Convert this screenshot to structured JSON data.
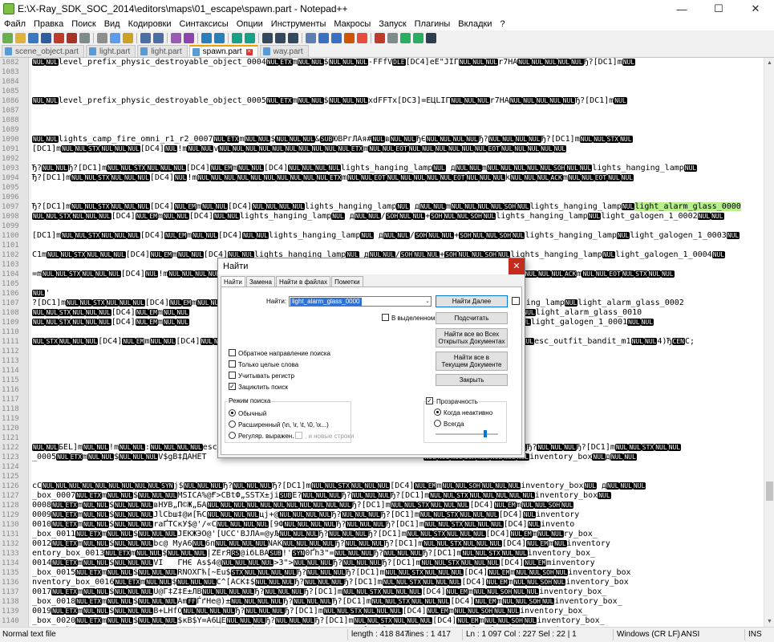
{
  "window": {
    "title": "E:\\X-Ray_SDK_SOC_2014\\editors\\maps\\01_escape\\spawn.part - Notepad++",
    "minimize": "—",
    "maximize": "☐",
    "close": "✕"
  },
  "menu": [
    "Файл",
    "Правка",
    "Поиск",
    "Вид",
    "Кодировки",
    "Синтаксисы",
    "Опции",
    "Инструменты",
    "Макросы",
    "Запуск",
    "Плагины",
    "Вкладки",
    "?"
  ],
  "tabs": [
    {
      "label": "scene_object.part",
      "active": false
    },
    {
      "label": "light.part",
      "active": false
    },
    {
      "label": "light.part",
      "active": false
    },
    {
      "label": "spawn.part",
      "active": true
    },
    {
      "label": "way.part",
      "active": false
    }
  ],
  "editor": {
    "lines": [
      {
        "n": "1082",
        "t": "[NUL][NUL]level_prefix_physic_destroyable_object_0004[NUL][ETX]m[NUL][NUL]$[NUL][NUL][NUL]-FFfV[DLE][DC4]eE\"JIГ[NUL][NUL][NUL]r7HA[NUL][NUL][NUL][NUL][NUL]Ђ?[DC1]m[NUL]"
      },
      {
        "n": "1083",
        "t": ""
      },
      {
        "n": "1084",
        "t": ""
      },
      {
        "n": "1085",
        "t": ""
      },
      {
        "n": "1086",
        "t": "[NUL][NUL]level_prefix_physic_destroyable_object_0005[NUL][ETX]m[NUL][NUL]$[NUL][NUL][NUL]xdFFTx[DC3]=ЕЦLIГ[NUL][NUL][NUL]r7HA[NUL][NUL][NUL][NUL][NUL]Ђ?[DC1]m[NUL]"
      },
      {
        "n": "1087",
        "t": ""
      },
      {
        "n": "1088",
        "t": ""
      },
      {
        "n": "1089",
        "t": ""
      },
      {
        "n": "1090",
        "t": "[NUL][NUL]lights_camp_fire_omni_r1_r2_0007[NUL][ETX]m[NUL][NUL]$[NUL][NUL][NUL]&[SUB]ЮВРгЛАя#[NUL]в[NUL][NUL]ЂЄ[NUL][NUL][NUL][NUL]Ђ?[NUL][NUL][NUL][NUL]Ђ?[DC1]m[NUL][NUL][STX][NUL]"
      },
      {
        "n": "1091",
        "t": "[DC1]m[NUL][NUL][STX][NUL][NUL][NUL][DC4][NUL]!m[NUL][NUL]v[NUL][NUL][NUL][NUL][NUL][NUL][NUL][NUL][NUL][NUL][ETX]m[NUL][NUL][EOT][NUL][NUL][NUL][NUL][NUL][NUL][EOT][NUL][NUL][NUL][NUL][NUL]"
      },
      {
        "n": "1092",
        "t": ""
      },
      {
        "n": "1093",
        "t": "Ђ?[NUL][NUL]Ђ?[DC1]m[NUL][NUL][STX][NUL][NUL][NUL][DC4][NUL][EM]m[NUL][NUL][DC4][NUL][NUL][NUL][NUL]lights_hanging_lamp[NUL] д[NUL][NUL]m[NUL][NUL][NUL][NUL][NUL][SOH][NUL][NUL]lights_hanging_lamp[NUL]"
      },
      {
        "n": "1094",
        "t": "Ђ?[DC1]m[NUL][NUL][STX][NUL][NUL][NUL][DC4][NUL]!m[NUL][NUL][NUL][NUL][NUL][NUL][NUL][NUL][NUL][NUL][ETX]m[NUL][NUL][EOT][NUL][NUL][NUL][NUL][NUL][EOT][NUL][NUL][NUL]k[NUL][NUL][NUL][ACK]m[NUL][NUL][EOT][NUL][NUL]"
      },
      {
        "n": "1095",
        "t": ""
      },
      {
        "n": "1096",
        "t": ""
      },
      {
        "n": "1097",
        "t": "Ђ?[DC1]m[NUL][NUL][STX][NUL][NUL][NUL][DC4][NUL][EM]m[NUL][NUL][DC4][NUL][NUL][NUL][NUL]lights_hanging_lamp[NUL] д[NUL][NUL]m[NUL][NUL][NUL][NUL][SOH][NUL]lights_hanging_lamp[NUL]{{hl}}"
      },
      {
        "n": "1098",
        "t": "[NUL][NUL][STX][NUL][NUL][NUL][DC4][NUL][EM]m[NUL][NUL][DC4][NUL][NUL]lights_hanging_lamp[NUL] д[NUL][NUL]/[SOH][NUL][NUL]+[SOH][NUL][NUL][SOH][NUL]lights_hanging_lamp[NUL]light_galogen_1_0002[NUL][NUL]"
      },
      {
        "n": "1099",
        "t": ""
      },
      {
        "n": "1100",
        "t": "[DC1]m[NUL][NUL][STX][NUL][NUL][NUL][DC4][NUL][EM]m[NUL][NUL][DC4][NUL][NUL]lights_hanging_lamp[NUL] д[NUL][NUL]/[SOH][NUL][NUL]+[SOH][NUL][NUL][SOH][NUL]lights_hanging_lamp[NUL]light_galogen_1_0003[NUL]"
      },
      {
        "n": "1101",
        "t": ""
      },
      {
        "n": "1102",
        "t": "C1m[NUL][NUL][STX][NUL][NUL][NUL][DC4][NUL][EM]m[NUL][NUL][DC4][NUL][NUL]lights_hanging_lamp[NUL] д[NUL][NUL]/[SOH][NUL][NUL]+[SOH][NUL][NUL][SOH][NUL]lights_hanging_lamp[NUL]light_galogen_1_0004[NUL]"
      },
      {
        "n": "1103",
        "t": ""
      },
      {
        "n": "1104",
        "t": "=m[NUL][NUL][STX][NUL][NUL][NUL][DC4][NUL]!m[NUL][NUL][NUL][NUL][NUL][NUL][NUL][NUL][NUL][NUL][NUL][NUL][NUL][NUL][NUL][NUL][NUL][NUL][NUL][NUL][NUL][NUL][NUL][NUL][NUL][NUL][NUL][NUL][NUL][NUL][ACK]m[NUL][NUL][EOT][NUL][STX][NUL][NUL]"
      },
      {
        "n": "1105",
        "t": ""
      },
      {
        "n": "1106",
        "t": "[NUL]'"
      },
      {
        "n": "1107",
        "t": "?[DC1]m[NUL][NUL][STX][NUL][NUL][NUL][DC4][NUL][EM]m[NUL][NUL]                                                 [SOH]lights_hanging_lamp[NUL]light_alarm_glass_0002"
      },
      {
        "n": "1108",
        "t": "[NUL][NUL][STX][NUL][NUL][NUL][DC4][NUL][EM]m[NUL][NUL]                                                 ]lights_hanging_lamp[NUL]light_alarm_glass_0010"
      },
      {
        "n": "1109",
        "t": "[NUL][NUL][STX][NUL][NUL][NUL][DC4][NUL][EM]m[NUL][NUL]                                                 lights_hanging_lamp[NUL]light_galogen_1_0001[NUL][NUL]"
      },
      {
        "n": "1110",
        "t": ""
      },
      {
        "n": "1111",
        "t": "[NUL][STX][NUL][NUL][NUL][DC4][NUL][EM]m[NUL][NUL][DC4][NUL][NUL]                                                 it_bandit_m1[NUL]esc_outfit_bandit_m1[NUL][NUL]4)Ђ[CEN]C;"
      },
      {
        "n": "1112",
        "t": ""
      },
      {
        "n": "1113",
        "t": ""
      },
      {
        "n": "1114",
        "t": ""
      },
      {
        "n": "1115",
        "t": ""
      },
      {
        "n": "1116",
        "t": ""
      },
      {
        "n": "1117",
        "t": ""
      },
      {
        "n": "1118",
        "t": ""
      },
      {
        "n": "1119",
        "t": ""
      },
      {
        "n": "1120",
        "t": ""
      },
      {
        "n": "1121",
        "t": ""
      },
      {
        "n": "1122",
        "t": "[NUL][NUL]БEL]m[NUL][NUL]!m[NUL][NUL]:[NUL][NUL][NUL][NUL]esc_zone_mos                                             iЅ[NUL][NUL][NUL]Ђ?[NUL][NUL][NUL]Ђ?[DC1]m[NUL][NUL][STX][NUL][NUL]"
      },
      {
        "n": "1123",
        "t": "_0005[NUL][ETX]m[NUL][NUL]$[NUL][NUL][NUL]V$gB‡ДАНЕТ                                             [NUL][NUL][NUL][SOH][NUL][NUL][NUL][NUL]inventory_box[NUL]д[NUL][NUL]"
      },
      {
        "n": "1124",
        "t": ""
      },
      {
        "n": "1125",
        "t": ""
      },
      {
        "n": "1126",
        "t": "cC[NUL][NUL][NUL][NUL][NUL][NUL][NUL][NUL][NUL][SYN]j$[NUL][NUL][NUL]Ђ?[NUL][NUL][NUL]Ђ?[DC1]m[NUL][NUL][STX][NUL][NUL][NUL][DC4][NUL][EM]m[NUL][NUL][SOH][NUL][NUL][NUL]inventory_box[NUL] д[NUL][NUL][NUL]"
      },
      {
        "n": "1127",
        "t": "_box_0007[NUL][ETX]m[NUL][NUL]$[NUL][NUL][NUL]MSICA%@Ғ>CBtФ„SSTX±jі[SUB]Е?[NUL][NUL][NUL]Ђ?[NUL][NUL][NUL]Ђ?[DC1]m[NUL][NUL][STX][NUL][NUL][NUL][NUL][NUL]inventory_box[NUL]"
      },
      {
        "n": "1128",
        "t": "0008[NUL][ETX]m[NUL][NUL]$[NUL][NUL][NUL]вНУВ„П©Ж„БА[NUL][NUL][NUL][NUL][NUL][NUL][NUL][NUL][NUL][NUL][NUL]Ђ?[DC1]m[NUL][NUL][STX][NUL][NUL][NUL][DC4][NUL][EM]m[NUL][NUL][SOH][NUL]"
      },
      {
        "n": "1129",
        "t": "0009[NUL][ETX]m[NUL][NUL]$[NUL][NUL][NUL]JlCbш‡@и[ЋС[NUL][NUL][NUL][NUL]цj+@[NUL][NUL][NUL][NUL]Ђ?[NUL][NUL][NUL]Ђ?[DC1]m[NUL][NUL][STX][NUL][NUL][NUL][DC4][NUL]inventory"
      },
      {
        "n": "1130",
        "t": "0010[NUL][ETX]m[NUL][NUL]$[NUL][NUL][NUL]rаҐТСкУ$@'/«С[NUL][NUL][NUL][NUL][9Ф[NUL][NUL][NUL][NUL]Ђ?[NUL][NUL][NUL]Ђ?[DC1]m[NUL][NUL][STX][NUL][NUL][NUL][DC4][NUL]invento"
      },
      {
        "n": "1131",
        "t": "_box_0011[NUL][ETX]m[NUL][NUL]$[NUL][NUL][NUL]ЈЕКЖЭО@'[UCС'BJЛА=@уЉ[NUL][NUL][NUL]Ђ?[NUL][NUL][NUL]Ђ?[DC1]m[NUL][NUL][STX][NUL][NUL][NUL][DC4][NUL][EM]m[NUL][NUL]ry_box_"
      },
      {
        "n": "1132",
        "t": "0012[NUL][ETX]m[NUL][NUL]$[NUL][NUL][NUL]bс@ МуА6[NUL]6п[NUL][NUL][NUL][NUL]NАК[NUL][NUL][NUL][NUL]Ђ?[NUL][NUL][NUL]Ђ?[DC1]m[NUL][NUL][STX][NUL][NUL][NUL][DC4][NUL][EM]m[NUL]inventory"
      },
      {
        "n": "1133",
        "t": "entory_box_0013[NUL][ETX]m[NUL][NUL]$[NUL][NUL][NUL]|ZЕrЯ[RS]@iбLВА[SUB]!'[SYN]0Ґh3\"=[NUL][NUL][NUL]Ђ?[NUL][NUL][NUL]Ђ?[DC1]m[NUL][NUL][STX][NUL][NUL]inventory_box_"
      },
      {
        "n": "1134",
        "t": "0014[NUL][ETX]m[NUL][NUL]$[NUL][NUL][NUL]VI   ГНЄ Аs$4@[NUL][NUL][NUL][NUL]>3\">[NUL][NUL][NUL]Ђ?[NUL][NUL][NUL]Ђ?[DC1]m[NUL][NUL][STX][NUL][NUL][NUL][DC4][NUL][EM]minventory"
      },
      {
        "n": "1135",
        "t": "_box_0015[NUL][ETX]m[NUL][NUL]$[NUL][NUL][NUL]RNOXГћ[~Еu$[STX][NUL][NUL][NUL][NUL]Ђ?[NUL][NUL][NUL]Ђ?[DC1]m[NUL][NUL][STX][NUL][NUL][NUL][DC4][NUL][EM]m[NUL][NUL][SOH][NUL]inventory_box"
      },
      {
        "n": "1136",
        "t": "nventory_box_0016[NUL][ETX]m[NUL][NUL]$[NUL][NUL][NUL]C^[ACК‡$[NUL][NUL][NUL]Ђ?[NUL][NUL][NUL]Ђ?[DC1]m[NUL][NUL][STX][NUL][NUL][NUL][DC4][NUL][EM]m[NUL][NUL][SOH][NUL]inventory_box"
      },
      {
        "n": "1137",
        "t": "0017[NUL][ETX]m[NUL][NUL]$[NUL][NUL][NUL]U@Г‡Z‡Е±ЛB[NUL][NUL][NUL][NUL]Ђ?[NUL][NUL][NUL]Ђ?[DC1]m[NUL][NUL][STX][NUL][NUL][NUL][DC4][NUL][EM]m[NUL][NUL][SOH][NUL][NUL]inventory_box_"
      },
      {
        "n": "1138",
        "t": "_box_0018[NUL][ETX]m[NUL][NUL]$[NUL][NUL][NUL]Аm[FF]ЃґНе@)±[NUL][NUL][NUL][NUL]Ђ?[NUL][NUL][NUL]Ђ?[DC1]m[NUL][NUL][STX][NUL][NUL][NUL][DC4][NUL][EM]m[NUL][NUL][SOH][NUL]inventory_box_"
      },
      {
        "n": "1139",
        "t": "0019[NUL][ETX]m[NUL][NUL]$[NUL][NUL][NUL]B+LHfО[NUL][NUL][NUL][NUL]Ђ?[NUL][NUL][NUL]Ђ?[DC1]m[NUL][NUL][STX][NUL][NUL][NUL][DC4][NUL][EM]m[NUL][NUL][SOH][NUL][NUL]inventory_box_"
      },
      {
        "n": "1140",
        "t": "_box_0020[NUL][ETX]m[NUL][NUL]$[NUL][NUL][NUL]$кВ$Y=А6ЦЕ[NUL][NUL][NUL]Ђ?[NUL][NUL][NUL]Ђ?[DC1]m[NUL][NUL][STX][NUL][NUL][NUL][DC4][NUL][EM]m[NUL][NUL][SOH][NUL]inventory_box_"
      },
      {
        "n": "1141",
        "t": "entory_box_0021[NUL][ETX]m[NUL][NUL]$[NUL][NUL][NUL]B$ТГеп\"@©(\\С[NUL][NUL][NUL]Ђ?[NUL][NUL][NUL]Ђ?[DC1]m[NUL][NUL][STX][NUL][NUL][NUL][DC4][NUL]inventory_box"
      }
    ],
    "highlight_text": "light_alarm_glass_0000"
  },
  "find_dialog": {
    "title": "Найти",
    "close": "✕",
    "tabs": [
      "Найти",
      "Замена",
      "Найти в файлах",
      "Пометки"
    ],
    "find_label": "Найти:",
    "find_value": "light_alarm_glass_0000",
    "buttons": {
      "find_next": "Найти Далее",
      "count": "Подсчитать",
      "find_all_open": "Найти все во Всех\nОткрытых Документах",
      "find_all_current": "Найти все в\nТекущем Документе",
      "close": "Закрыть"
    },
    "in_selection": "В выделенном",
    "options": {
      "backward": {
        "label": "Обратное направление поиска",
        "checked": false
      },
      "whole_word": {
        "label": "Только целые слова",
        "checked": false
      },
      "match_case": {
        "label": "Учитывать регистр",
        "checked": false
      },
      "wrap": {
        "label": "Зациклить поиск",
        "checked": true
      }
    },
    "search_mode": {
      "title": "Режим поиска",
      "normal": "Обычный",
      "extended": "Расширенный (\\n, \\r, \\t, \\0, \\x...)",
      "regex": "Регуляр. выражен.",
      "newline": ". и новые строки",
      "selected": "normal"
    },
    "transparency": {
      "title": "Прозрачность",
      "checked": true,
      "on_inactive": "Когда неактивно",
      "always": "Всегда",
      "selected": "on_inactive",
      "level": 0.8
    }
  },
  "statusbar": {
    "filetype": "Normal text file",
    "length": "length : 418 847",
    "lines": "lines : 1 417",
    "position": "Ln : 1 097   Col : 227   Sel : 22 | 1",
    "eol": "Windows (CR LF)",
    "encoding": "ANSI",
    "mode": "INS"
  },
  "colors": {
    "ctl_bg": "#000000",
    "highlight": "#b7f08a",
    "selection": "#3072d4",
    "active_tab": "#f0a000"
  }
}
